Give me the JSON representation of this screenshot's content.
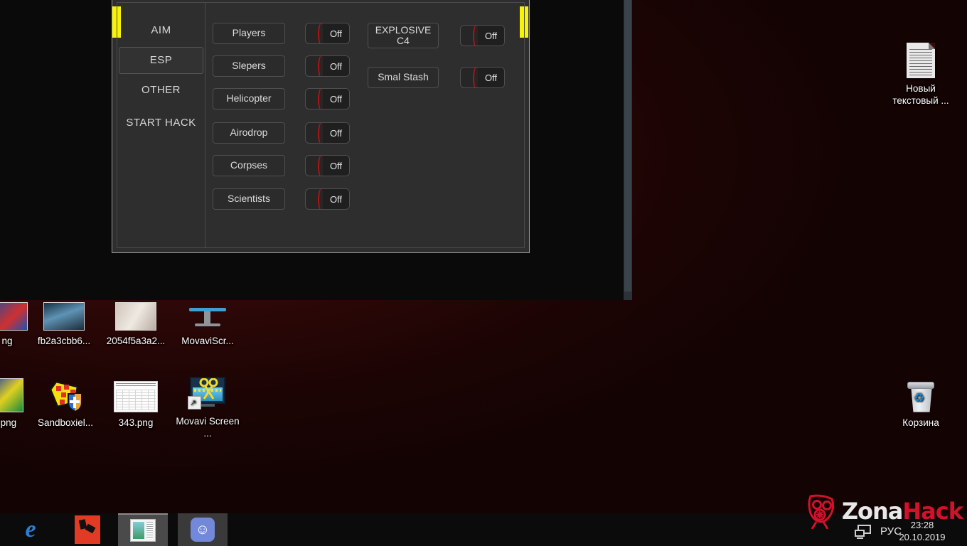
{
  "desktop": {
    "background_color": "#3a0a0a",
    "icons": [
      {
        "label": "Новый текстовый ...",
        "type": "text-document"
      },
      {
        "label": "Корзина",
        "type": "recycle-bin"
      },
      {
        "label": "ng",
        "type": "image-thumbnail"
      },
      {
        "label": "fb2a3cbb6...",
        "type": "image-thumbnail"
      },
      {
        "label": "2054f5a3a2...",
        "type": "image-thumbnail"
      },
      {
        "label": "MovaviScr...",
        "type": "monitor-shortcut"
      },
      {
        "label": ".png",
        "type": "image-thumbnail"
      },
      {
        "label": "Sandboxiel...",
        "type": "sandboxie"
      },
      {
        "label": "343.png",
        "type": "spreadsheet-thumbnail"
      },
      {
        "label": "Movavi Screen ...",
        "type": "movavi-screen-recorder"
      }
    ]
  },
  "viewer": {
    "name": "screenshot-viewer-black-area"
  },
  "cheat_panel": {
    "tabs": [
      {
        "label": "AIM",
        "selected": false
      },
      {
        "label": "ESP",
        "selected": true
      },
      {
        "label": "OTHER",
        "selected": false
      },
      {
        "label": "START HACK",
        "selected": false
      }
    ],
    "left_column": [
      {
        "label": "Players",
        "toggle": "Off"
      },
      {
        "label": "Slepers",
        "toggle": "Off"
      },
      {
        "label": "Helicopter",
        "toggle": "Off"
      },
      {
        "label": "Airodrop",
        "toggle": "Off"
      },
      {
        "label": "Corpses",
        "toggle": "Off"
      },
      {
        "label": "Scientists",
        "toggle": "Off"
      }
    ],
    "right_column": [
      {
        "label": "EXPLOSIVE C4",
        "toggle": "Off"
      },
      {
        "label": "Smal Stash",
        "toggle": "Off"
      }
    ],
    "accent_marker_color": "#f7f307",
    "toggle_accent_color": "#b01515"
  },
  "taskbar": {
    "items": [
      {
        "label": "Microsoft Edge",
        "icon": "edge-icon",
        "active": false
      },
      {
        "label": "Red App",
        "icon": "red-app-icon",
        "active": false
      },
      {
        "label": "Photos",
        "icon": "photos-icon",
        "active": true
      },
      {
        "label": "Discord",
        "icon": "discord-icon",
        "active": false
      }
    ],
    "tray": {
      "language": "РУС",
      "time": "23:28",
      "date": "20.10.2019"
    }
  },
  "watermark": {
    "text_left": "Zona",
    "text_right": "Hack",
    "logo": "gas-mask-icon"
  }
}
